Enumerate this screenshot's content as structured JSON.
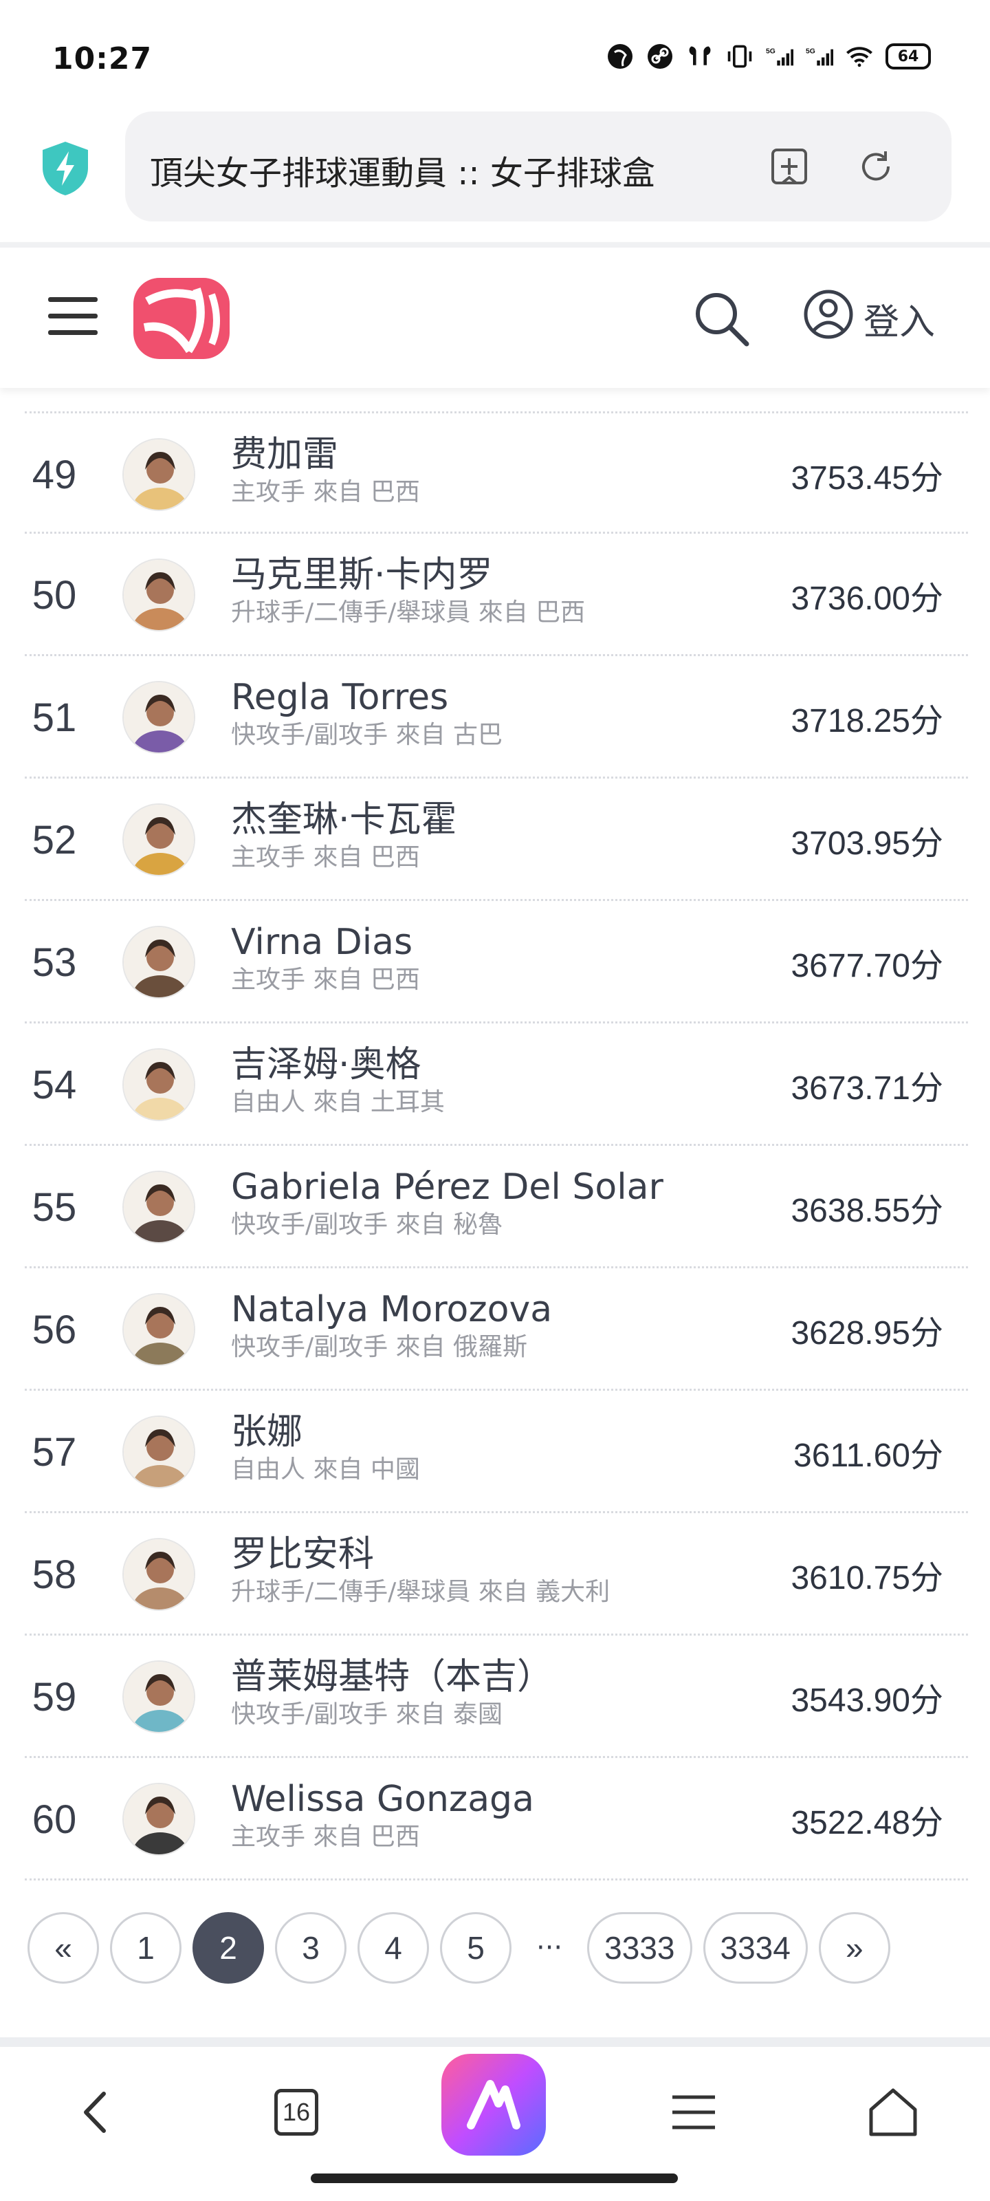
{
  "status_bar": {
    "time": "10:27",
    "battery": "64",
    "icons": [
      "vpn-globe-icon",
      "link-icon",
      "earbuds-icon",
      "vibrate-icon",
      "signal-5g-icon",
      "signal-5g-icon",
      "wifi-icon",
      "battery-icon"
    ]
  },
  "browser": {
    "url_title": "頂尖女子排球運動員 :: 女子排球盒",
    "icons": [
      "shield-bolt-icon",
      "bookmark-add-icon",
      "reload-icon"
    ]
  },
  "site_header": {
    "login_label": "登入",
    "icons": [
      "menu-icon",
      "volleyball-logo",
      "search-icon",
      "user-icon"
    ]
  },
  "players": [
    {
      "rank": "49",
      "name": "费加雷",
      "desc": "主攻手 來自 巴西",
      "score": "3753.45分"
    },
    {
      "rank": "50",
      "name": "马克里斯·卡内罗",
      "desc": "升球手/二傳手/舉球員 來自 巴西",
      "score": "3736.00分"
    },
    {
      "rank": "51",
      "name": "Regla Torres",
      "desc": "快攻手/副攻手 來自 古巴",
      "score": "3718.25分"
    },
    {
      "rank": "52",
      "name": "杰奎琳·卡瓦霍",
      "desc": "主攻手 來自 巴西",
      "score": "3703.95分"
    },
    {
      "rank": "53",
      "name": "Virna Dias",
      "desc": "主攻手 來自 巴西",
      "score": "3677.70分"
    },
    {
      "rank": "54",
      "name": "吉泽姆·奥格",
      "desc": "自由人 來自 土耳其",
      "score": "3673.71分"
    },
    {
      "rank": "55",
      "name": "Gabriela Pérez Del Solar",
      "desc": "快攻手/副攻手 來自 秘魯",
      "score": "3638.55分"
    },
    {
      "rank": "56",
      "name": "Natalya Morozova",
      "desc": "快攻手/副攻手 來自 俄羅斯",
      "score": "3628.95分"
    },
    {
      "rank": "57",
      "name": "张娜",
      "desc": "自由人 來自 中國",
      "score": "3611.60分"
    },
    {
      "rank": "58",
      "name": "罗比安科",
      "desc": "升球手/二傳手/舉球員 來自 義大利",
      "score": "3610.75分"
    },
    {
      "rank": "59",
      "name": "普莱姆基特（本吉）",
      "desc": "快攻手/副攻手 來自 泰國",
      "score": "3543.90分"
    },
    {
      "rank": "60",
      "name": "Welissa Gonzaga",
      "desc": "主攻手 來自 巴西",
      "score": "3522.48分"
    }
  ],
  "pagination": {
    "first": "«",
    "pages": [
      "1",
      "2",
      "3",
      "4",
      "5"
    ],
    "active": "2",
    "ellipsis": "···",
    "tail_pages": [
      "3333",
      "3334"
    ],
    "last": "»"
  },
  "bottom_nav": {
    "tabs_count": "16",
    "icons": [
      "back-icon",
      "tabs-icon",
      "assistant-icon",
      "menu-icon",
      "home-icon"
    ]
  },
  "colors": {
    "accent_logo": "#f0506e",
    "active_page": "#4a4f5e",
    "shield": "#3ec7c0"
  }
}
